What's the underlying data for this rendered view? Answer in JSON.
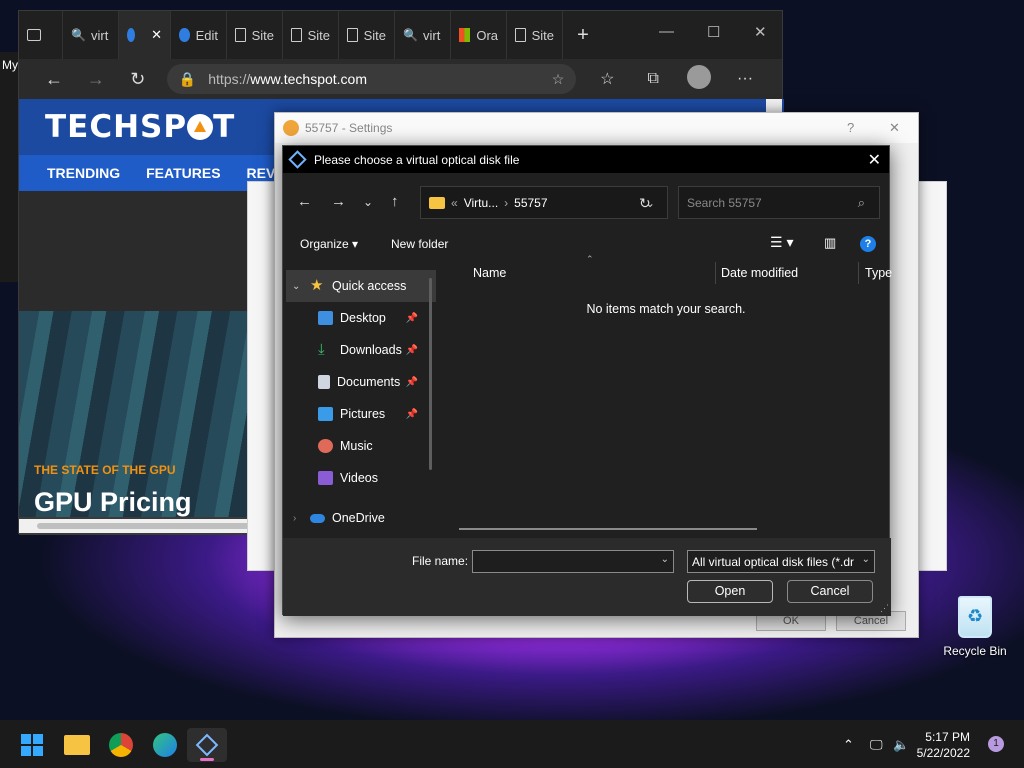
{
  "desktop": {
    "left_fragment": "My",
    "recycle_bin_label": "Recycle Bin"
  },
  "browser": {
    "tabs": [
      {
        "label": "virt",
        "icon": "search-icon"
      },
      {
        "label": "",
        "icon": "virtualbox-icon"
      },
      {
        "label": "Edit",
        "icon": "edit-icon"
      },
      {
        "label": "Site",
        "icon": "page-icon"
      },
      {
        "label": "Site",
        "icon": "page-icon"
      },
      {
        "label": "Site",
        "icon": "page-icon"
      },
      {
        "label": "virt",
        "icon": "search-icon"
      },
      {
        "label": "Ora",
        "icon": "microsoft-icon"
      },
      {
        "label": "Site",
        "icon": "page-icon"
      }
    ],
    "url_prefix": "https://",
    "url_domain": "www.techspot.com",
    "site": {
      "logo": "TECHSP",
      "logo_end": "T",
      "nav": [
        "TRENDING",
        "FEATURES",
        "REVI"
      ],
      "hero_kicker": "THE STATE OF THE GPU",
      "hero_title": "GPU Pricing"
    }
  },
  "settings_window": {
    "title": "55757 - Settings",
    "ok_label": "OK",
    "cancel_label": "Cancel"
  },
  "dialog": {
    "title": "Please choose a virtual optical disk file",
    "breadcrumb": {
      "prefix": "«",
      "parent": "Virtu...",
      "current": "55757"
    },
    "search_placeholder": "Search 55757",
    "commands": {
      "organize": "Organize ▾",
      "new_folder": "New folder"
    },
    "nav_items": [
      {
        "label": "Quick access",
        "icon": "star-icon",
        "pinned": false
      },
      {
        "label": "Desktop",
        "icon": "desktop-icon",
        "pinned": true
      },
      {
        "label": "Downloads",
        "icon": "download-icon",
        "pinned": true
      },
      {
        "label": "Documents",
        "icon": "documents-icon",
        "pinned": true
      },
      {
        "label": "Pictures",
        "icon": "pictures-icon",
        "pinned": true
      },
      {
        "label": "Music",
        "icon": "music-icon",
        "pinned": false
      },
      {
        "label": "Videos",
        "icon": "videos-icon",
        "pinned": false
      },
      {
        "label": "OneDrive",
        "icon": "cloud-icon",
        "pinned": false
      }
    ],
    "columns": {
      "name": "Name",
      "date_modified": "Date modified",
      "type": "Type"
    },
    "empty_message": "No items match your search.",
    "file_name_label": "File name:",
    "file_name_value": "",
    "filter_value": "All virtual optical disk files (*.dr",
    "open_label": "Open",
    "cancel_label": "Cancel"
  },
  "taskbar": {
    "time": "5:17 PM",
    "date": "5/22/2022",
    "notification_count": "1"
  },
  "colors": {
    "accent_blue": "#1f5cc8",
    "brand_orange": "#f29111",
    "dialog_bg": "#202020"
  }
}
